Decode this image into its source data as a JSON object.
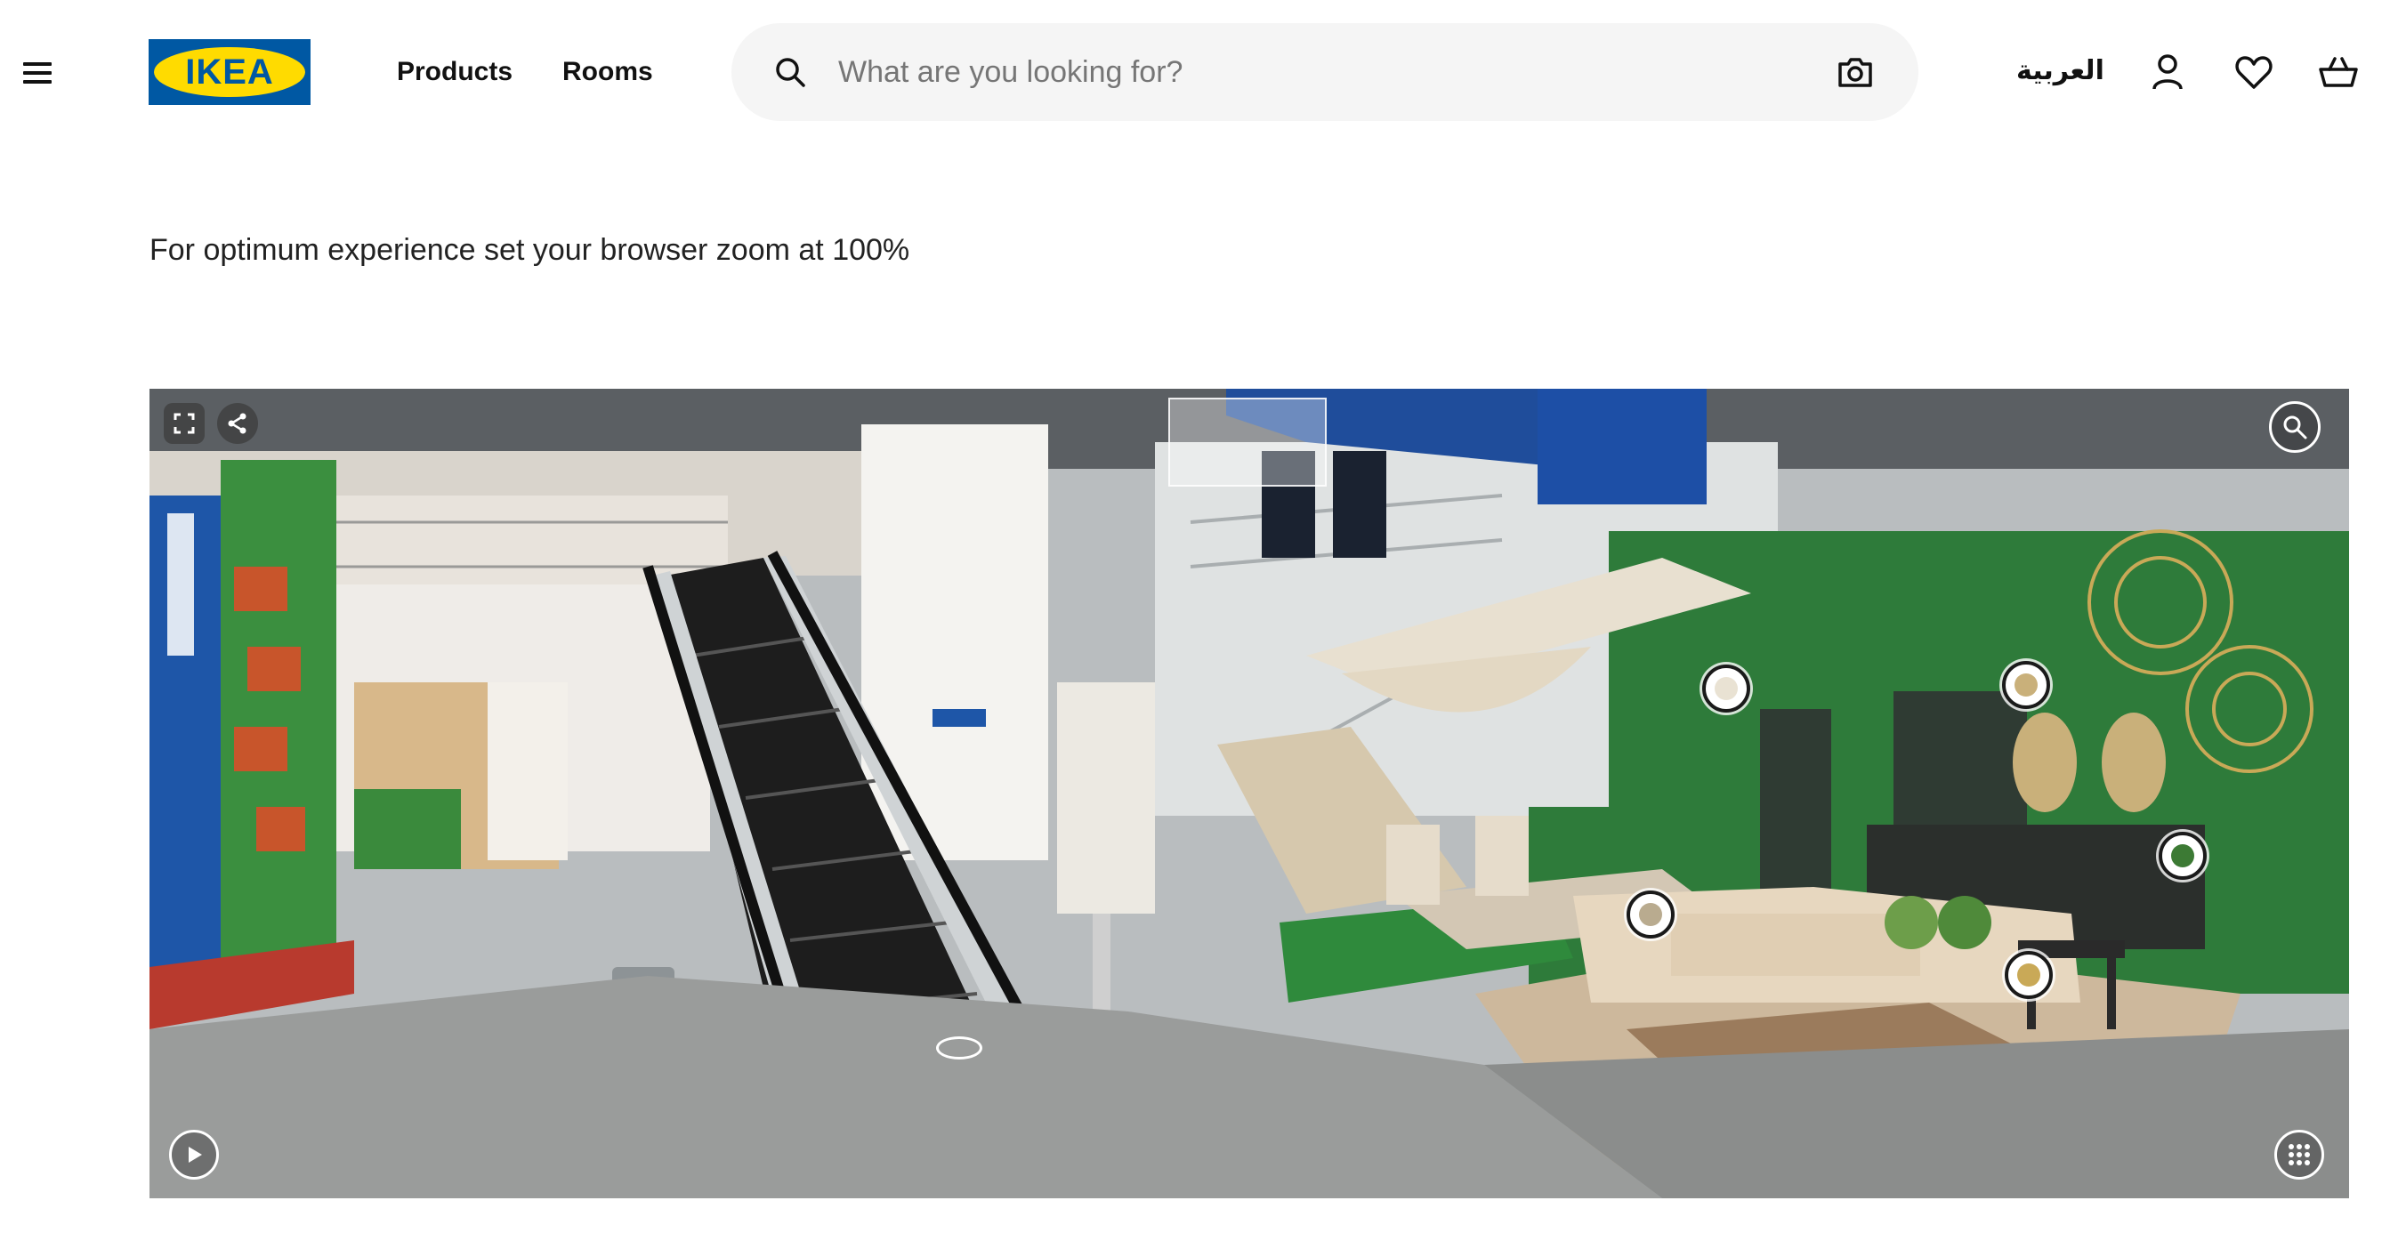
{
  "header": {
    "menu_icon": "hamburger-menu-icon",
    "logo_text": "IKEA",
    "nav": [
      {
        "label": "Products"
      },
      {
        "label": "Rooms"
      }
    ],
    "search": {
      "placeholder": "What are you looking for?",
      "value": "",
      "search_icon": "search-icon",
      "camera_icon": "camera-icon"
    },
    "language_label": "العربية",
    "icons": [
      "user-icon",
      "heart-icon",
      "basket-icon"
    ]
  },
  "notice": "For optimum experience set your browser zoom at 100%",
  "viewer": {
    "controls": {
      "fullscreen_icon": "fullscreen-icon",
      "share_icon": "share-icon",
      "zoom_icon": "zoom-icon",
      "play_icon": "play-icon",
      "grid_icon": "grid-icon"
    },
    "hotspot_count": 6
  },
  "colors": {
    "brand_blue": "#0058a3",
    "brand_yellow": "#ffdb00",
    "search_bg": "#f5f5f5",
    "wall_green": "#2e7b3a"
  }
}
